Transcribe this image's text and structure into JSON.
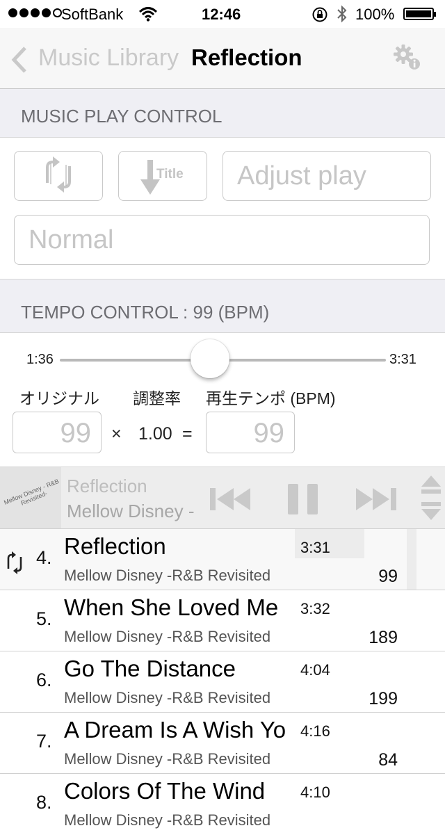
{
  "status": {
    "carrier": "SoftBank",
    "time": "12:46",
    "battery": "100%"
  },
  "nav": {
    "back_label": "Music Library",
    "title": "Reflection"
  },
  "music_play_control": {
    "header": "MUSIC PLAY CONTROL",
    "sort_button_label": "Title",
    "adjust_play_placeholder": "Adjust play",
    "mode_placeholder": "Normal"
  },
  "tempo_control": {
    "header": "TEMPO CONTROL : 99 (BPM)",
    "slider_start": "1:36",
    "slider_end": "3:31",
    "slider_position": 0.46,
    "label_original": "オリジナル",
    "label_rate": "調整率",
    "label_playback": "再生テンポ (BPM)",
    "original_value": "99",
    "multiply": "×",
    "rate_value": "1.00",
    "equals": "=",
    "playback_value": "99"
  },
  "player": {
    "artwork_text": "Mellow Disney - R&B Revisited-",
    "title": "Reflection",
    "artist": "Mellow Disney -"
  },
  "tracks": [
    {
      "num": "4.",
      "title": "Reflection",
      "album": "Mellow Disney -R&B Revisited",
      "duration": "3:31",
      "bpm": "99",
      "current": true
    },
    {
      "num": "5.",
      "title": "When She Loved Me",
      "album": "Mellow Disney -R&B Revisited",
      "duration": "3:32",
      "bpm": "189"
    },
    {
      "num": "6.",
      "title": "Go The Distance",
      "album": "Mellow Disney -R&B Revisited",
      "duration": "4:04",
      "bpm": "199"
    },
    {
      "num": "7.",
      "title": "A Dream Is A Wish Yo",
      "album": "Mellow Disney -R&B Revisited",
      "duration": "4:16",
      "bpm": "84"
    },
    {
      "num": "8.",
      "title": "Colors Of The Wind",
      "album": "Mellow Disney -R&B Revisited",
      "duration": "4:10",
      "bpm": ""
    }
  ]
}
